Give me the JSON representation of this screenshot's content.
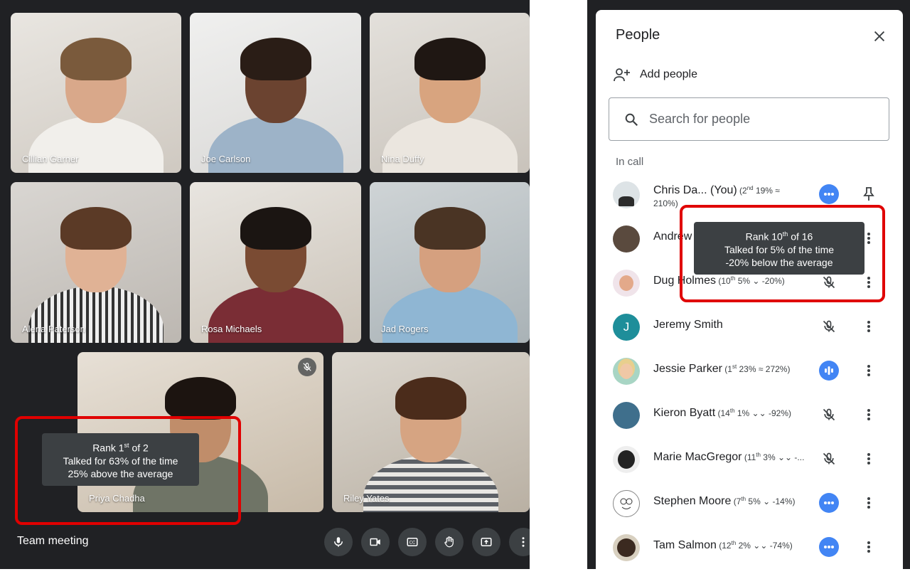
{
  "meeting": {
    "title": "Team meeting",
    "tiles": [
      {
        "name": "Cillian Garner"
      },
      {
        "name": "Joe Carlson"
      },
      {
        "name": "Nina Duffy"
      },
      {
        "name": "Alena Paterson"
      },
      {
        "name": "Rosa Michaels"
      },
      {
        "name": "Jad Rogers"
      },
      {
        "name": "Priya Chadha"
      },
      {
        "name": "Riley Yates"
      }
    ],
    "tile_tooltip": {
      "rank_prefix": "Rank 1",
      "rank_sup": "st",
      "rank_suffix": " of 2",
      "line2": "Talked for 63% of the time",
      "line3": "25% above the average"
    },
    "controls": [
      "mic-icon",
      "camera-icon",
      "captions-icon",
      "raise-hand-icon",
      "present-icon",
      "more-options-icon"
    ]
  },
  "panel": {
    "title": "People",
    "add_people": "Add people",
    "search_placeholder": "Search for people",
    "section": "In call",
    "tooltip": {
      "rank_prefix": "Rank 10",
      "rank_sup": "th",
      "rank_suffix": " of 16",
      "line2": "Talked for 5% of the time",
      "line3": "-20% below the average"
    },
    "people": [
      {
        "name": "Chris Da...",
        "you": "(You)",
        "stat_a": " (2",
        "stat_sup": "nd",
        "stat_b": " 19% ≈",
        "stat_c": "210%)",
        "action": "more-dots"
      },
      {
        "name": "Andrew",
        "action": "muted"
      },
      {
        "name": "Dug Holmes",
        "stat_a": " (10",
        "stat_sup": "th",
        "stat_b": " 5% ⌄ -20%)",
        "action": "muted"
      },
      {
        "name": "Jeremy Smith",
        "initial": "J",
        "action": "muted"
      },
      {
        "name": "Jessie Parker",
        "stat_a": " (1",
        "stat_sup": "st",
        "stat_b": " 23% ≈ 272%)",
        "action": "speaking"
      },
      {
        "name": "Kieron Byatt",
        "stat_a": " (14",
        "stat_sup": "th",
        "stat_b": " 1% ⌄⌄ -92%)",
        "action": "muted"
      },
      {
        "name": "Marie MacGregor",
        "stat_a": " (11",
        "stat_sup": "th",
        "stat_b": " 3% ⌄⌄ -...",
        "action": "muted"
      },
      {
        "name": "Stephen Moore",
        "stat_a": " (7",
        "stat_sup": "th",
        "stat_b": " 5% ⌄ -14%)",
        "action": "more-dots"
      },
      {
        "name": "Tam Salmon",
        "stat_a": " (12",
        "stat_sup": "th",
        "stat_b": " 2% ⌄⌄ -74%)",
        "action": "more-dots"
      }
    ]
  },
  "colors": {
    "accent": "#4285f4",
    "highlight": "#e00000",
    "call_bg": "#202124",
    "tooltip_bg": "#3c4043"
  }
}
